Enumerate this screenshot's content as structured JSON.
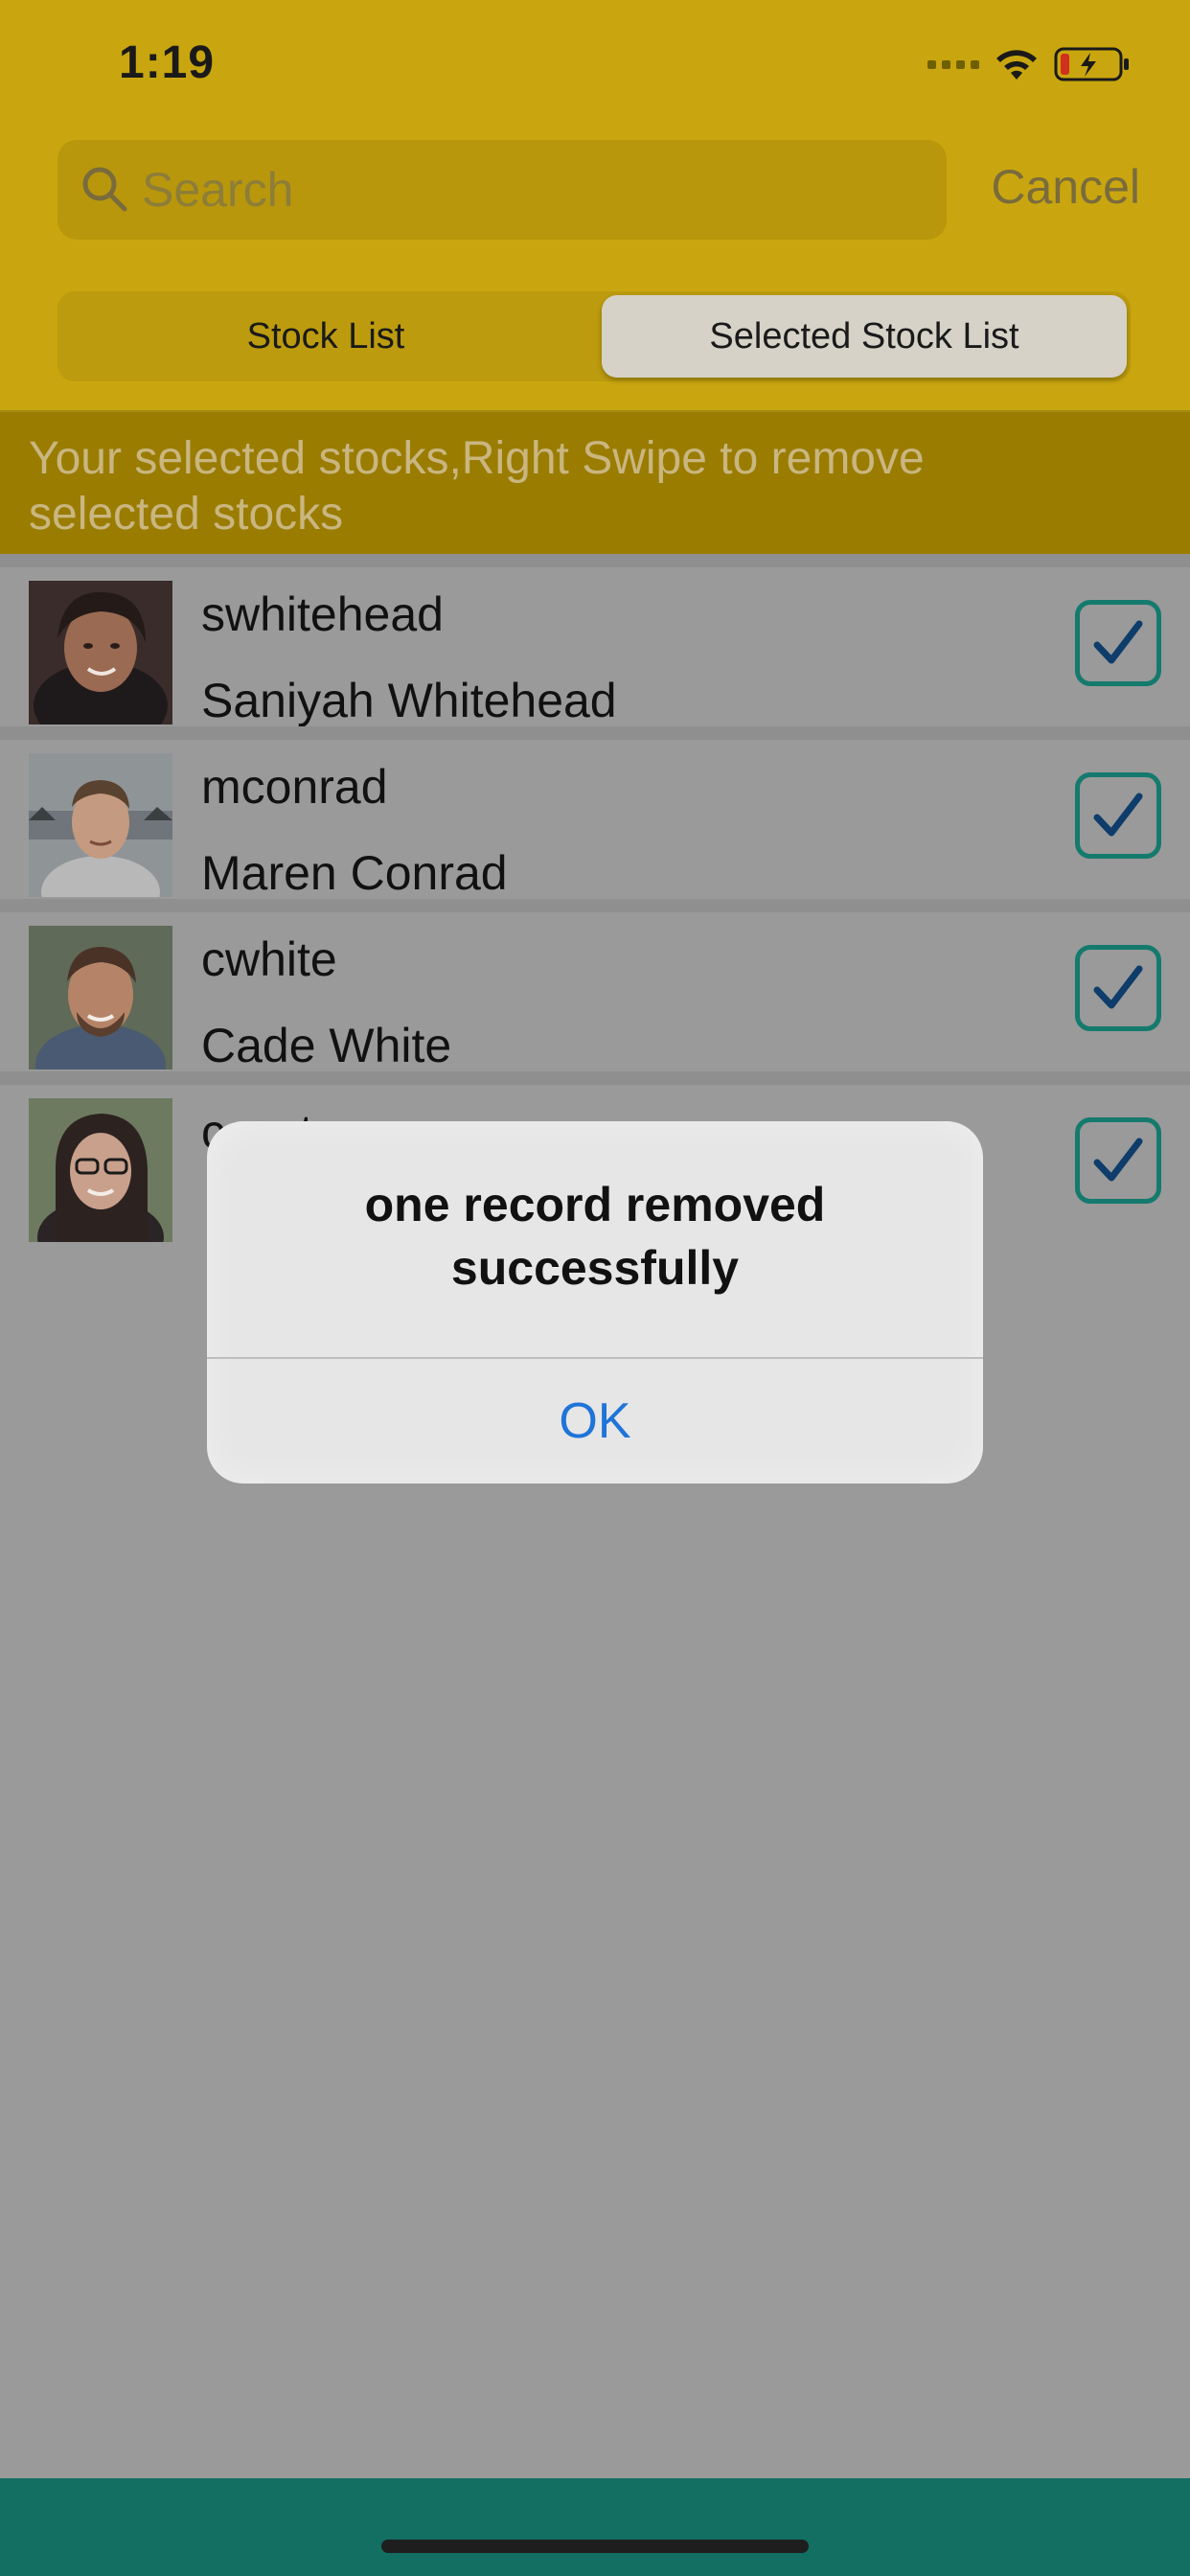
{
  "status": {
    "time": "1:19"
  },
  "search": {
    "placeholder": "Search",
    "value": "",
    "cancel_label": "Cancel"
  },
  "segments": [
    {
      "label": "Stock List",
      "selected": false
    },
    {
      "label": "Selected Stock List",
      "selected": true
    }
  ],
  "banner_text": "Your selected stocks,Right Swipe to remove selected stocks",
  "rows": [
    {
      "username": "swhitehead",
      "fullname": "Saniyah Whitehead",
      "checked": true
    },
    {
      "username": "mconrad",
      "fullname": "Maren Conrad",
      "checked": true
    },
    {
      "username": "cwhite",
      "fullname": "Cade White",
      "checked": true
    },
    {
      "username": "csexton",
      "fullname": "",
      "checked": true
    }
  ],
  "alert": {
    "message": "one record removed successfully",
    "ok_label": "OK"
  },
  "colors": {
    "header": "#c9a60f",
    "banner": "#9a7c00",
    "accent": "#157a6e",
    "alert_button": "#1e74d8",
    "bottombar": "#126f62"
  }
}
